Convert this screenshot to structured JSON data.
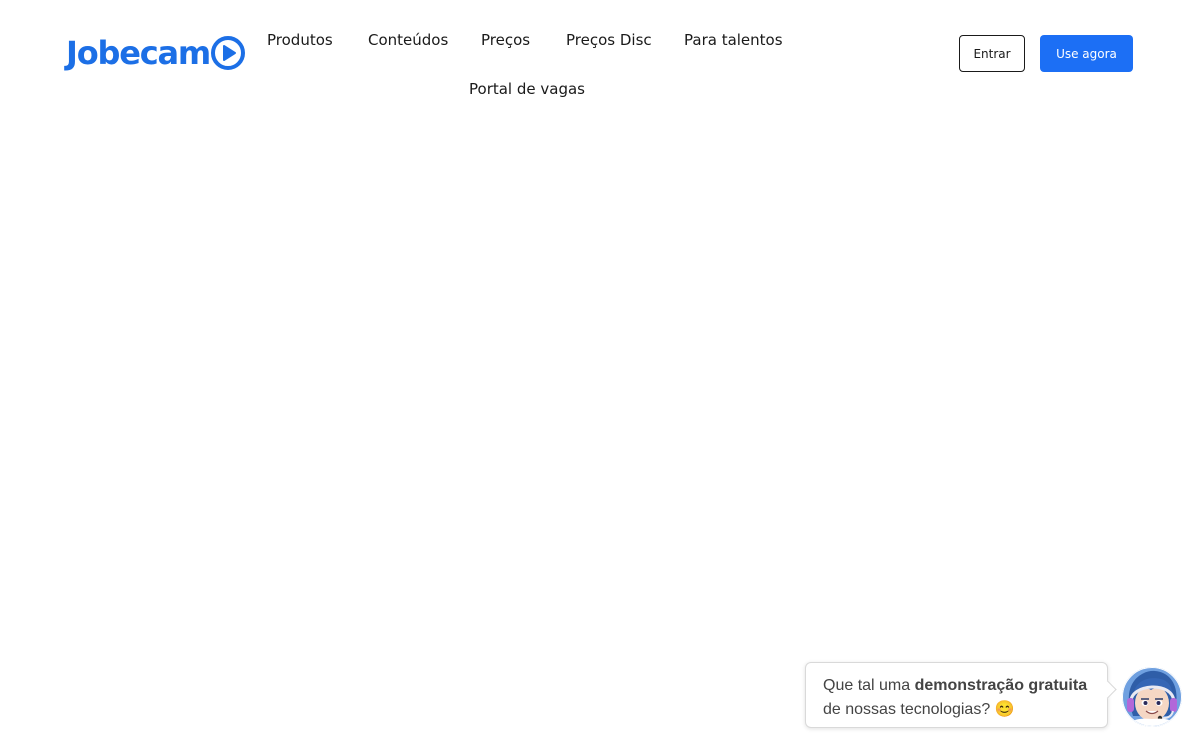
{
  "header": {
    "logo_text": "Jobecam",
    "nav": {
      "produtos": "Produtos",
      "conteudos": "Conteúdos",
      "precos": "Preços",
      "precos_disc": "Preços Disc",
      "talentos": "Para talentos",
      "portal": "Portal de vagas"
    },
    "entrar_label": "Entrar",
    "use_agora_label": "Use agora"
  },
  "chat": {
    "part1": "Que tal uma ",
    "part2": "demonstração gratuita",
    "part3": " de nossas tecnologias? 😊"
  },
  "colors": {
    "brand": "#1c6fe6",
    "primary_button": "#1c6ff5"
  },
  "icons": {
    "logo_play": "play-circle-icon",
    "chat_avatar": "assistant-avatar-icon"
  }
}
